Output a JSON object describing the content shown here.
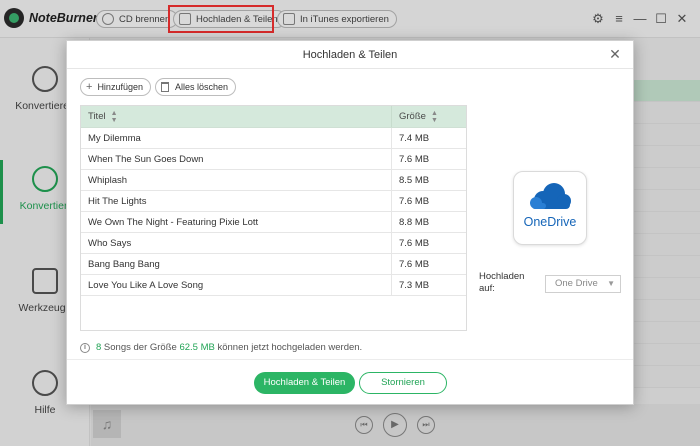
{
  "app": {
    "name": "NoteBurner",
    "toolbar": {
      "burn_cd": "CD brennen",
      "upload_share": "Hochladen & Teilen",
      "export_itunes": "In iTunes exportieren"
    },
    "sidebar": {
      "items": [
        {
          "label": "Konvertieren",
          "icon": "convert-icon"
        },
        {
          "label": "Konvertiert",
          "icon": "clock-icon"
        },
        {
          "label": "Werkzeuge",
          "icon": "toolbox-icon"
        },
        {
          "label": "Hilfe",
          "icon": "help-icon"
        }
      ]
    }
  },
  "dialog": {
    "title": "Hochladen & Teilen",
    "add_button": "Hinzufügen",
    "clear_button": "Alles löschen",
    "table": {
      "headers": {
        "title": "Titel",
        "size": "Größe"
      },
      "rows": [
        {
          "title": "My Dilemma",
          "size": "7.4 MB"
        },
        {
          "title": "When The Sun Goes Down",
          "size": "7.6 MB"
        },
        {
          "title": "Whiplash",
          "size": "8.5 MB"
        },
        {
          "title": "Hit The Lights",
          "size": "7.6 MB"
        },
        {
          "title": "We Own The Night - Featuring Pixie Lott",
          "size": "8.8 MB"
        },
        {
          "title": "Who Says",
          "size": "7.6 MB"
        },
        {
          "title": "Bang Bang Bang",
          "size": "7.6 MB"
        },
        {
          "title": "Love You Like A Love Song",
          "size": "7.3 MB"
        }
      ]
    },
    "service_name": "OneDrive",
    "upload_to_label": "Hochladen auf:",
    "upload_to_value": "One Drive",
    "info": {
      "count": "8",
      "part1": " Songs der Größe ",
      "total": "62.5 MB",
      "part2": " können jetzt hochgeladen werden."
    },
    "primary_button": "Hochladen & Teilen",
    "cancel_button": "Stornieren"
  },
  "colors": {
    "accent": "#2cb565",
    "table_header": "#d5e9dc",
    "onedrive_blue": "#1565b8",
    "highlight": "#d62b2b"
  }
}
